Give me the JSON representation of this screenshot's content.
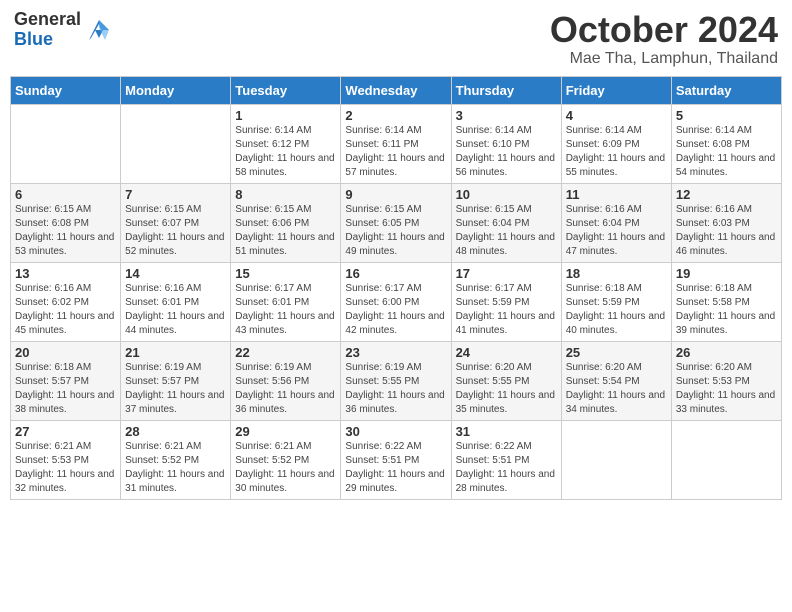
{
  "header": {
    "logo_general": "General",
    "logo_blue": "Blue",
    "month": "October 2024",
    "location": "Mae Tha, Lamphun, Thailand"
  },
  "days_of_week": [
    "Sunday",
    "Monday",
    "Tuesday",
    "Wednesday",
    "Thursday",
    "Friday",
    "Saturday"
  ],
  "weeks": [
    [
      {
        "day": "",
        "info": ""
      },
      {
        "day": "",
        "info": ""
      },
      {
        "day": "1",
        "info": "Sunrise: 6:14 AM\nSunset: 6:12 PM\nDaylight: 11 hours and 58 minutes."
      },
      {
        "day": "2",
        "info": "Sunrise: 6:14 AM\nSunset: 6:11 PM\nDaylight: 11 hours and 57 minutes."
      },
      {
        "day": "3",
        "info": "Sunrise: 6:14 AM\nSunset: 6:10 PM\nDaylight: 11 hours and 56 minutes."
      },
      {
        "day": "4",
        "info": "Sunrise: 6:14 AM\nSunset: 6:09 PM\nDaylight: 11 hours and 55 minutes."
      },
      {
        "day": "5",
        "info": "Sunrise: 6:14 AM\nSunset: 6:08 PM\nDaylight: 11 hours and 54 minutes."
      }
    ],
    [
      {
        "day": "6",
        "info": "Sunrise: 6:15 AM\nSunset: 6:08 PM\nDaylight: 11 hours and 53 minutes."
      },
      {
        "day": "7",
        "info": "Sunrise: 6:15 AM\nSunset: 6:07 PM\nDaylight: 11 hours and 52 minutes."
      },
      {
        "day": "8",
        "info": "Sunrise: 6:15 AM\nSunset: 6:06 PM\nDaylight: 11 hours and 51 minutes."
      },
      {
        "day": "9",
        "info": "Sunrise: 6:15 AM\nSunset: 6:05 PM\nDaylight: 11 hours and 49 minutes."
      },
      {
        "day": "10",
        "info": "Sunrise: 6:15 AM\nSunset: 6:04 PM\nDaylight: 11 hours and 48 minutes."
      },
      {
        "day": "11",
        "info": "Sunrise: 6:16 AM\nSunset: 6:04 PM\nDaylight: 11 hours and 47 minutes."
      },
      {
        "day": "12",
        "info": "Sunrise: 6:16 AM\nSunset: 6:03 PM\nDaylight: 11 hours and 46 minutes."
      }
    ],
    [
      {
        "day": "13",
        "info": "Sunrise: 6:16 AM\nSunset: 6:02 PM\nDaylight: 11 hours and 45 minutes."
      },
      {
        "day": "14",
        "info": "Sunrise: 6:16 AM\nSunset: 6:01 PM\nDaylight: 11 hours and 44 minutes."
      },
      {
        "day": "15",
        "info": "Sunrise: 6:17 AM\nSunset: 6:01 PM\nDaylight: 11 hours and 43 minutes."
      },
      {
        "day": "16",
        "info": "Sunrise: 6:17 AM\nSunset: 6:00 PM\nDaylight: 11 hours and 42 minutes."
      },
      {
        "day": "17",
        "info": "Sunrise: 6:17 AM\nSunset: 5:59 PM\nDaylight: 11 hours and 41 minutes."
      },
      {
        "day": "18",
        "info": "Sunrise: 6:18 AM\nSunset: 5:59 PM\nDaylight: 11 hours and 40 minutes."
      },
      {
        "day": "19",
        "info": "Sunrise: 6:18 AM\nSunset: 5:58 PM\nDaylight: 11 hours and 39 minutes."
      }
    ],
    [
      {
        "day": "20",
        "info": "Sunrise: 6:18 AM\nSunset: 5:57 PM\nDaylight: 11 hours and 38 minutes."
      },
      {
        "day": "21",
        "info": "Sunrise: 6:19 AM\nSunset: 5:57 PM\nDaylight: 11 hours and 37 minutes."
      },
      {
        "day": "22",
        "info": "Sunrise: 6:19 AM\nSunset: 5:56 PM\nDaylight: 11 hours and 36 minutes."
      },
      {
        "day": "23",
        "info": "Sunrise: 6:19 AM\nSunset: 5:55 PM\nDaylight: 11 hours and 36 minutes."
      },
      {
        "day": "24",
        "info": "Sunrise: 6:20 AM\nSunset: 5:55 PM\nDaylight: 11 hours and 35 minutes."
      },
      {
        "day": "25",
        "info": "Sunrise: 6:20 AM\nSunset: 5:54 PM\nDaylight: 11 hours and 34 minutes."
      },
      {
        "day": "26",
        "info": "Sunrise: 6:20 AM\nSunset: 5:53 PM\nDaylight: 11 hours and 33 minutes."
      }
    ],
    [
      {
        "day": "27",
        "info": "Sunrise: 6:21 AM\nSunset: 5:53 PM\nDaylight: 11 hours and 32 minutes."
      },
      {
        "day": "28",
        "info": "Sunrise: 6:21 AM\nSunset: 5:52 PM\nDaylight: 11 hours and 31 minutes."
      },
      {
        "day": "29",
        "info": "Sunrise: 6:21 AM\nSunset: 5:52 PM\nDaylight: 11 hours and 30 minutes."
      },
      {
        "day": "30",
        "info": "Sunrise: 6:22 AM\nSunset: 5:51 PM\nDaylight: 11 hours and 29 minutes."
      },
      {
        "day": "31",
        "info": "Sunrise: 6:22 AM\nSunset: 5:51 PM\nDaylight: 11 hours and 28 minutes."
      },
      {
        "day": "",
        "info": ""
      },
      {
        "day": "",
        "info": ""
      }
    ]
  ]
}
